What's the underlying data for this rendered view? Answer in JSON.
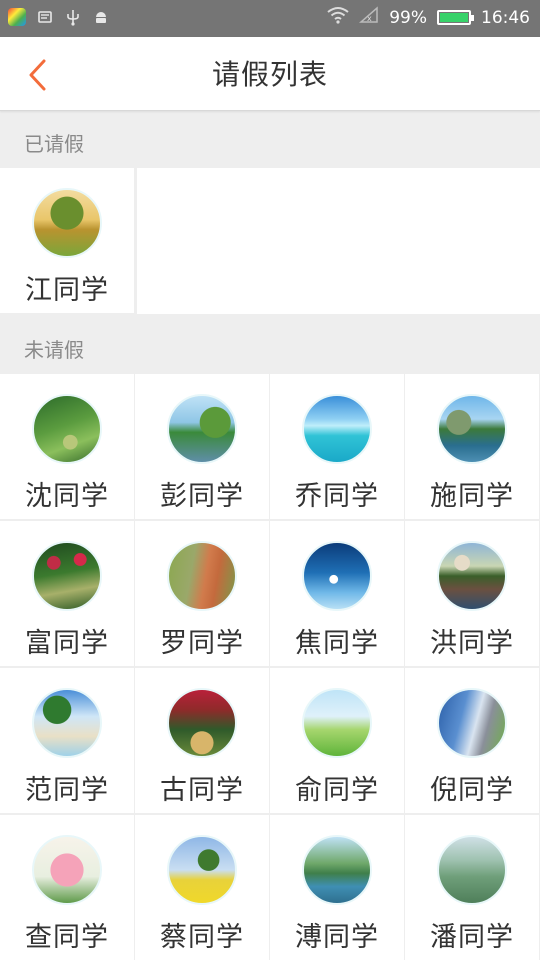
{
  "status_bar": {
    "battery": "99%",
    "battery_level": 0.99,
    "time": "16:46"
  },
  "header": {
    "title": "请假列表",
    "back_icon": "chevron-left-icon",
    "accent_color": "#f36c3b"
  },
  "sections": {
    "on_leave": {
      "label": "已请假",
      "students": [
        {
          "name": "江同学",
          "avatar": "tree-field"
        }
      ]
    },
    "not_on_leave": {
      "label": "未请假",
      "students": [
        {
          "name": "沈同学",
          "avatar": "forest-path"
        },
        {
          "name": "彭同学",
          "avatar": "pond-willows"
        },
        {
          "name": "乔同学",
          "avatar": "ocean-beach"
        },
        {
          "name": "施同学",
          "avatar": "lake-mountain"
        },
        {
          "name": "富同学",
          "avatar": "garden-flowers"
        },
        {
          "name": "罗同学",
          "avatar": "cliff-canyon"
        },
        {
          "name": "焦同学",
          "avatar": "dandelion-sky"
        },
        {
          "name": "洪同学",
          "avatar": "castle-lake"
        },
        {
          "name": "范同学",
          "avatar": "palm-beach"
        },
        {
          "name": "古同学",
          "avatar": "flower-arch"
        },
        {
          "name": "俞同学",
          "avatar": "bicycle-meadow"
        },
        {
          "name": "倪同学",
          "avatar": "building-grass"
        },
        {
          "name": "查同学",
          "avatar": "lotus-flower"
        },
        {
          "name": "蔡同学",
          "avatar": "tree-canola"
        },
        {
          "name": "溥同学",
          "avatar": "river-karst"
        },
        {
          "name": "潘同学",
          "avatar": "misty-mountains"
        }
      ]
    }
  }
}
